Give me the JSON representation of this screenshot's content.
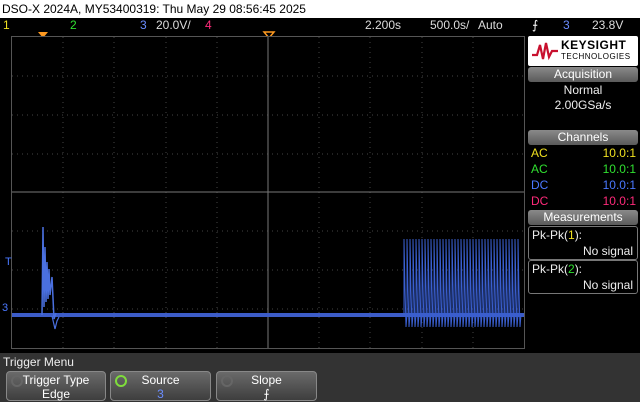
{
  "title": "DSO-X 2024A, MY53400319: Thu May 29 08:56:45 2025",
  "status": {
    "ch1": "1",
    "ch2": "2",
    "ch3": "3",
    "ch3_scale": "20.0V/",
    "ch4": "4",
    "time_delay": "2.200s",
    "time_scale": "500.0s/",
    "trigger_mode": "Auto",
    "trigger_edge_glyph": "⨍",
    "trigger_source": "3",
    "trigger_level": "23.8V"
  },
  "markers": {
    "ch3_ground": "3",
    "trigger_T": "T"
  },
  "brand": {
    "name": "KEYSIGHT",
    "sub": "TECHNOLOGIES"
  },
  "acquisition": {
    "header": "Acquisition",
    "mode": "Normal",
    "rate": "2.00GSa/s"
  },
  "channels": {
    "header": "Channels",
    "rows": [
      {
        "coupling": "AC",
        "probe": "10.0:1",
        "color": "#f0e020"
      },
      {
        "coupling": "AC",
        "probe": "10.0:1",
        "color": "#30e030"
      },
      {
        "coupling": "DC",
        "probe": "10.0:1",
        "color": "#4a78ff"
      },
      {
        "coupling": "DC",
        "probe": "10.0:1",
        "color": "#ff2a7a"
      }
    ]
  },
  "measurements": {
    "header": "Measurements",
    "items": [
      {
        "label_pre": "Pk-Pk(",
        "channel": "1",
        "label_post": "):",
        "value": "No signal"
      },
      {
        "label_pre": "Pk-Pk(",
        "channel": "2",
        "label_post": "):",
        "value": "No signal"
      }
    ]
  },
  "menu": {
    "title": "Trigger Menu",
    "buttons": [
      {
        "label": "Trigger Type",
        "value": "Edge"
      },
      {
        "label": "Source",
        "value": "3"
      },
      {
        "label": "Slope",
        "value": "⨍"
      }
    ]
  },
  "colors": {
    "ch1": "#f0e020",
    "ch2": "#30e030",
    "ch3": "#4a78ff",
    "ch4": "#ff2a7a",
    "trigger_marker": "#ff9a20"
  }
}
